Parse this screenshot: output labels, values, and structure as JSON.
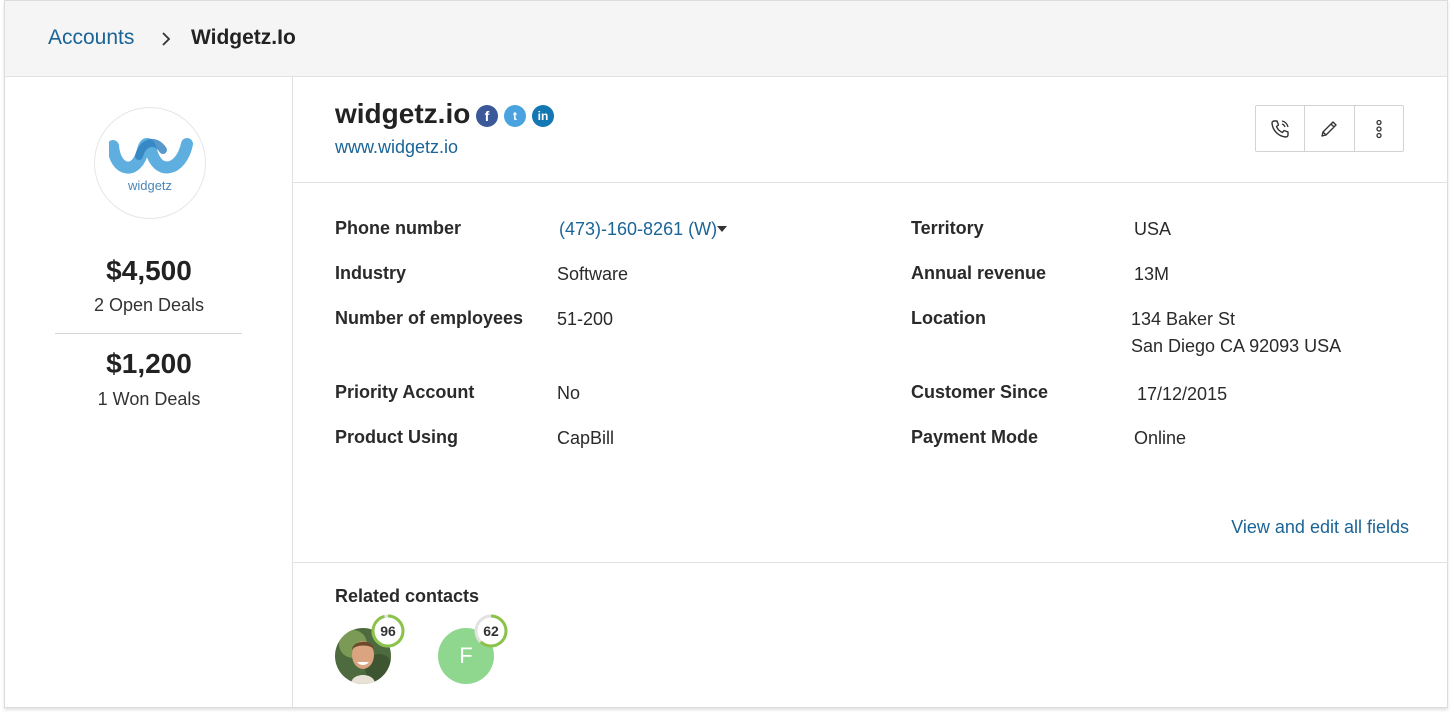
{
  "breadcrumb": {
    "parent": "Accounts",
    "current": "Widgetz.Io"
  },
  "account": {
    "name": "widgetz.io",
    "website": "www.widgetz.io",
    "logo_text": "widgetz",
    "social": [
      "facebook-icon",
      "twitter-icon",
      "linkedin-icon"
    ]
  },
  "stats": {
    "open_amount": "$4,500",
    "open_label": "2 Open Deals",
    "won_amount": "$1,200",
    "won_label": "1 Won Deals"
  },
  "actions": [
    "phone-icon",
    "pencil-icon",
    "more-vertical-icon"
  ],
  "fields": {
    "phone_label": "Phone number",
    "phone_value": "(473)-160-8261 (W)",
    "industry_label": "Industry",
    "industry_value": "Software",
    "employees_label": "Number of employees",
    "employees_value": "51-200",
    "priority_label": "Priority Account",
    "priority_value": "No",
    "product_label": "Product Using",
    "product_value": "CapBill",
    "territory_label": "Territory",
    "territory_value": "USA",
    "revenue_label": "Annual revenue",
    "revenue_value": "13M",
    "location_label": "Location",
    "location_line1": "134 Baker St",
    "location_line2": "San Diego CA 92093 USA",
    "customer_since_label": "Customer Since",
    "customer_since_value": "17/12/2015",
    "payment_label": "Payment Mode",
    "payment_value": "Online"
  },
  "view_all": "View and edit all fields",
  "related": {
    "title": "Related contacts",
    "contacts": [
      {
        "score": "96",
        "initial": "",
        "photo": true
      },
      {
        "score": "62",
        "initial": "F",
        "photo": false
      }
    ]
  },
  "colors": {
    "link": "#1a6496",
    "score_ring": "#8bc34a",
    "avatar_f": "#8fd68f"
  }
}
